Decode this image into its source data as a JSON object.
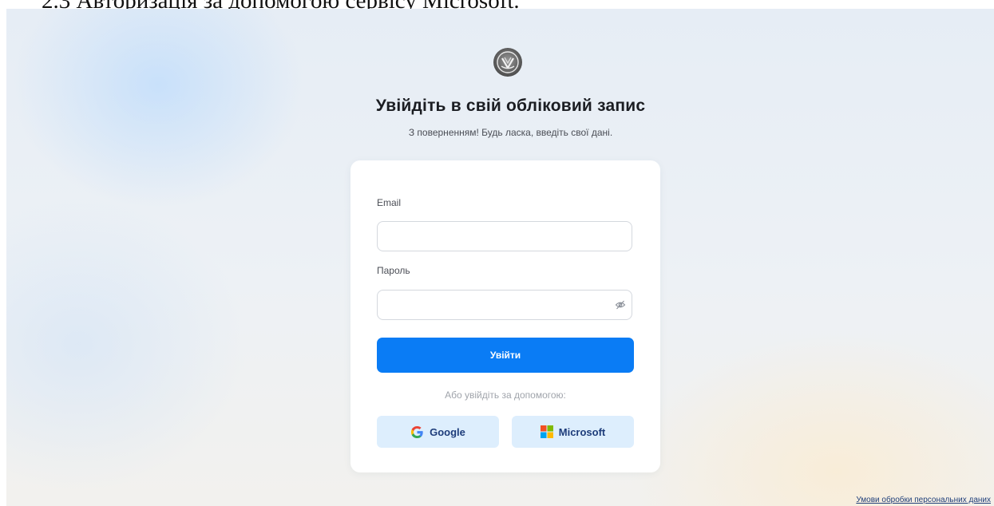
{
  "document": {
    "heading": "2.3 Авторизація за допомогою сервісу Microsoft."
  },
  "header": {
    "logo_icon": "university-crest-icon",
    "title": "Увійдіть в свій обліковий запис",
    "subtitle": "З поверненням! Будь ласка, введіть свої дані."
  },
  "form": {
    "email_label": "Email",
    "email_value": "",
    "password_label": "Пароль",
    "password_value": "",
    "password_toggle_icon": "eye-off-icon",
    "submit_label": "Увійти",
    "alt_text": "Або увійдіть за допомогою:",
    "google_label": "Google",
    "microsoft_label": "Microsoft"
  },
  "footer": {
    "privacy_link": "Умови обробки персональних даних"
  },
  "colors": {
    "primary": "#0a7cf5",
    "sso_background": "#ddeefd",
    "sso_text": "#1d3c7a"
  }
}
